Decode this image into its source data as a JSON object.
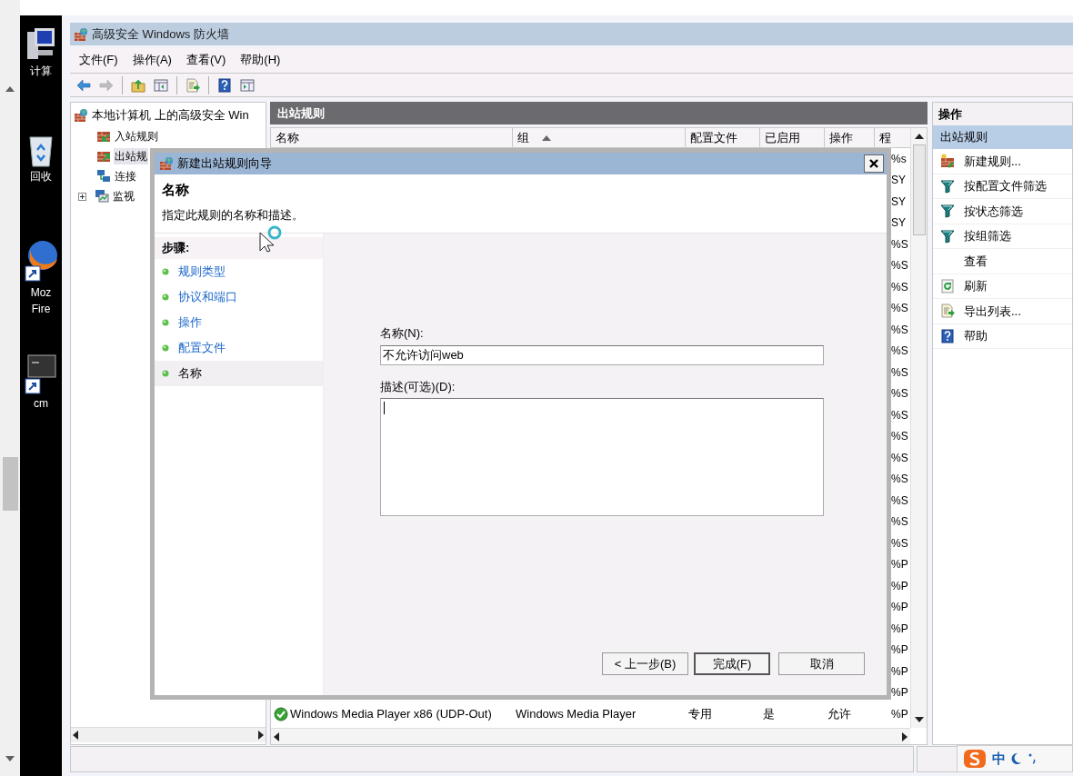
{
  "desktop": {
    "icons": [
      {
        "kind": "computer",
        "lines": [
          "计算"
        ]
      },
      {
        "kind": "recycle",
        "lines": [
          "回收"
        ]
      },
      {
        "kind": "browser",
        "lines": [
          "Moz",
          "Fire"
        ]
      },
      {
        "kind": "console",
        "lines": [
          "cm"
        ]
      }
    ]
  },
  "window": {
    "title": "高级安全 Windows 防火墙"
  },
  "menu": [
    {
      "label": "文件(F)"
    },
    {
      "label": "操作(A)"
    },
    {
      "label": "查看(V)"
    },
    {
      "label": "帮助(H)"
    }
  ],
  "toolbar": [
    {
      "kind": "back",
      "disabled": false
    },
    {
      "kind": "forward",
      "disabled": true
    },
    {
      "kind": "separator"
    },
    {
      "kind": "up",
      "disabled": false
    },
    {
      "kind": "tree",
      "disabled": false
    },
    {
      "kind": "separator"
    },
    {
      "kind": "export",
      "disabled": false
    },
    {
      "kind": "separator"
    },
    {
      "kind": "help",
      "disabled": false
    },
    {
      "kind": "pane",
      "disabled": false
    }
  ],
  "tree": {
    "root": {
      "label": "本地计算机 上的高级安全 Win",
      "children": [
        {
          "label": "入站规则",
          "kind": "inbound",
          "selected": false
        },
        {
          "label": "出站规",
          "kind": "outbound",
          "selected": true
        },
        {
          "label": "连接",
          "kind": "connection",
          "selected": false
        },
        {
          "label": "监视",
          "kind": "monitor",
          "selected": false,
          "expanded": false
        }
      ]
    }
  },
  "list": {
    "title": "出站规则",
    "columns": [
      {
        "label": "名称",
        "sorted": false
      },
      {
        "label": "组",
        "sorted": true
      },
      {
        "label": "配置文件",
        "sorted": false
      },
      {
        "label": "已启用",
        "sorted": false
      },
      {
        "label": "操作",
        "sorted": false
      },
      {
        "label": "程",
        "sorted": false
      }
    ],
    "rows": [
      {
        "program": "%s"
      },
      {
        "program": "SY"
      },
      {
        "program": "SY"
      },
      {
        "program": "SY"
      },
      {
        "program": "%S"
      },
      {
        "program": "%S"
      },
      {
        "program": "%S"
      },
      {
        "program": "%S"
      },
      {
        "program": "%S"
      },
      {
        "program": "%S"
      },
      {
        "program": "%S"
      },
      {
        "program": "%S"
      },
      {
        "program": "%S"
      },
      {
        "program": "%S"
      },
      {
        "program": "%S"
      },
      {
        "program": "%S"
      },
      {
        "program": "%S"
      },
      {
        "program": "%S"
      },
      {
        "program": "%S"
      },
      {
        "program": "%P"
      },
      {
        "program": "%P"
      },
      {
        "program": "%P"
      },
      {
        "program": "%P"
      },
      {
        "program": "%P"
      },
      {
        "program": "%P"
      },
      {
        "program": "%P"
      },
      {
        "name": "Windows Media Player x86 (UDP-Out)",
        "group": "Windows Media Player",
        "profile": "专用",
        "enabled": "是",
        "action": "允许",
        "program": "%P"
      }
    ]
  },
  "actions": {
    "title": "操作",
    "section": "出站规则",
    "items": [
      {
        "label": "新建规则...",
        "kind": "new-rule"
      },
      {
        "label": "按配置文件筛选",
        "kind": "filter"
      },
      {
        "label": "按状态筛选",
        "kind": "filter"
      },
      {
        "label": "按组筛选",
        "kind": "filter"
      },
      {
        "label": "查看",
        "kind": "none"
      },
      {
        "label": "刷新",
        "kind": "refresh"
      },
      {
        "label": "导出列表...",
        "kind": "export"
      },
      {
        "label": "帮助",
        "kind": "help"
      }
    ]
  },
  "dialog": {
    "title": "新建出站规则向导",
    "heading": "名称",
    "subtitle": "指定此规则的名称和描述。",
    "steps_title": "步骤:",
    "steps": [
      {
        "label": "规则类型",
        "selected": false
      },
      {
        "label": "协议和端口",
        "selected": false
      },
      {
        "label": "操作",
        "selected": false
      },
      {
        "label": "配置文件",
        "selected": false
      },
      {
        "label": "名称",
        "selected": true
      }
    ],
    "name_label": "名称(N):",
    "name_value": "不允许访问web",
    "desc_label": "描述(可选)(D):",
    "buttons": [
      {
        "label": "< 上一步(B)",
        "default": false
      },
      {
        "label": "完成(F)",
        "default": true
      },
      {
        "label": "取消",
        "default": false
      }
    ]
  },
  "ime": {
    "label": "中"
  }
}
